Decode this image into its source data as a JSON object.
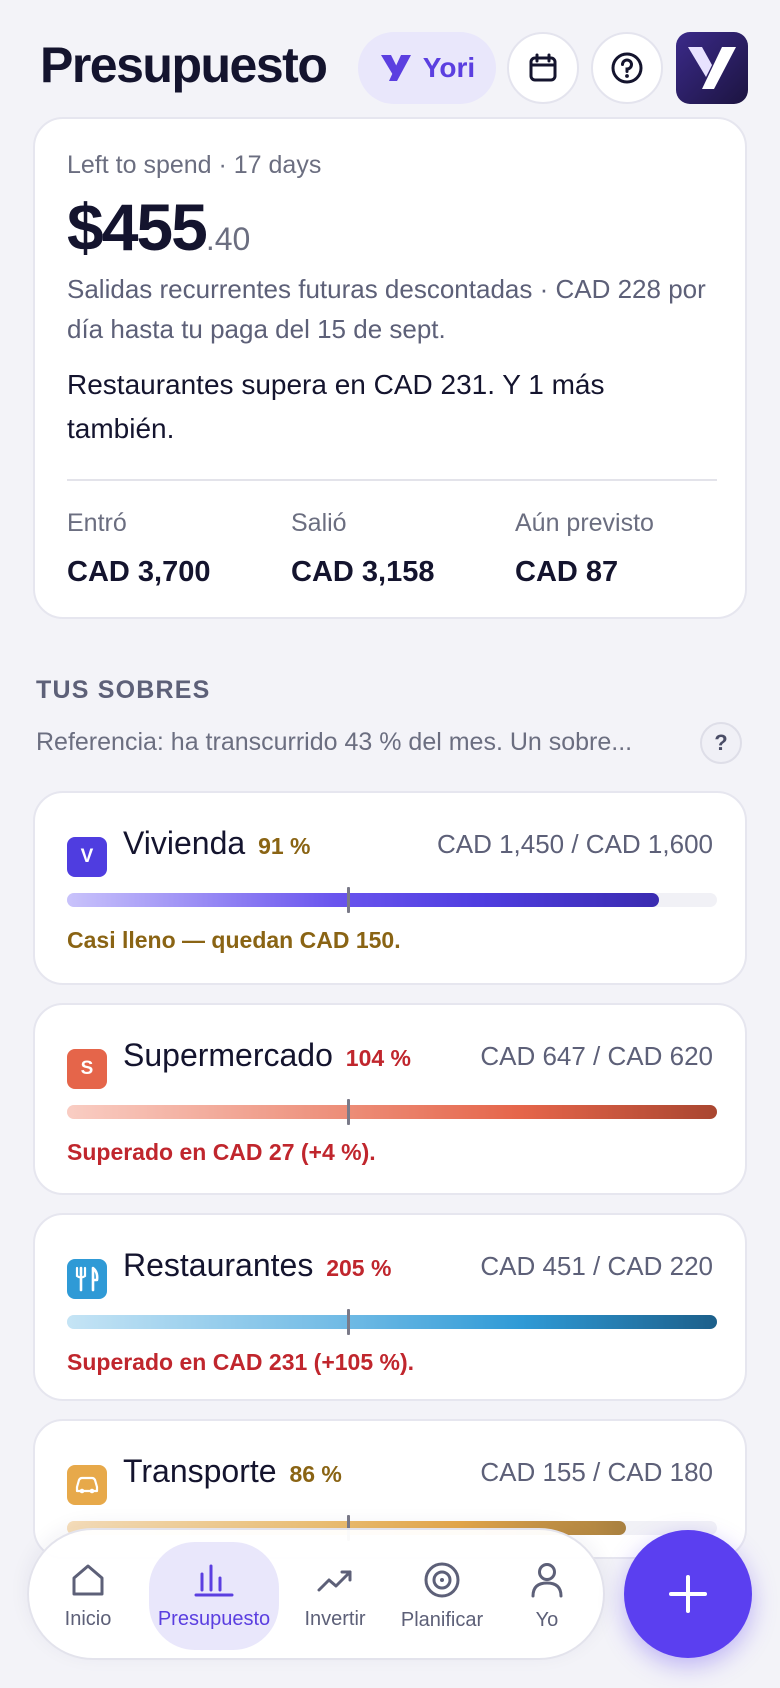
{
  "header": {
    "title": "Presupuesto",
    "assistant_label": "Yori"
  },
  "summary": {
    "left_label": "Left to spend · 17 days",
    "amount_main": "$455",
    "amount_cents": ".40",
    "description": "Salidas recurrentes futuras descontadas · CAD 228 por día hasta tu paga del 15 de sept.",
    "alert": "Restaurantes supera en CAD 231. Y 1 más también.",
    "stats": [
      {
        "label": "Entró",
        "value": "CAD 3,700"
      },
      {
        "label": "Salió",
        "value": "CAD 3,158"
      },
      {
        "label": "Aún previsto",
        "value": "CAD 87"
      }
    ]
  },
  "envelopes_section": {
    "title": "TUS SOBRES",
    "reference": "Referencia: ha transcurrido 43 % del mes. Un sobre...",
    "help_label": "?",
    "month_elapsed_fraction": 0.43
  },
  "envelopes": [
    {
      "badge": "V",
      "name": "Vivienda",
      "pct": "91 %",
      "amounts": "CAD 1,450 / CAD 1,600",
      "note": "Casi lleno — quedan CAD 150.",
      "fill_fraction": 0.91,
      "color": "#4f3de0",
      "status_color": "#8a6414"
    },
    {
      "badge": "S",
      "name": "Supermercado",
      "pct": "104 %",
      "amounts": "CAD 647 / CAD 620",
      "note": "Superado en CAD 27 (+4 %).",
      "fill_fraction": 1.0,
      "color": "#e5654a",
      "status_color": "#c0262d"
    },
    {
      "badge": "fork-knife-icon",
      "name": "Restaurantes",
      "pct": "205 %",
      "amounts": "CAD 451 / CAD 220",
      "note": "Superado en CAD 231 (+105 %).",
      "fill_fraction": 1.0,
      "color": "#2f9ad6",
      "status_color": "#c0262d"
    },
    {
      "badge": "car-icon",
      "name": "Transporte",
      "pct": "86 %",
      "amounts": "CAD 155 / CAD 180",
      "note": "",
      "fill_fraction": 0.86,
      "color": "#e7a94a",
      "status_color": "#8a6414"
    }
  ],
  "nav": [
    {
      "label": "Inicio",
      "icon": "home-icon"
    },
    {
      "label": "Presupuesto",
      "icon": "bar-chart-icon",
      "active": true
    },
    {
      "label": "Invertir",
      "icon": "trending-up-icon"
    },
    {
      "label": "Planificar",
      "icon": "target-icon"
    },
    {
      "label": "Yo",
      "icon": "person-icon"
    }
  ],
  "colors": {
    "accent": "#5b3ff0",
    "background": "#f3f3f8",
    "text_primary": "#14142e",
    "text_secondary": "#5d6078"
  }
}
